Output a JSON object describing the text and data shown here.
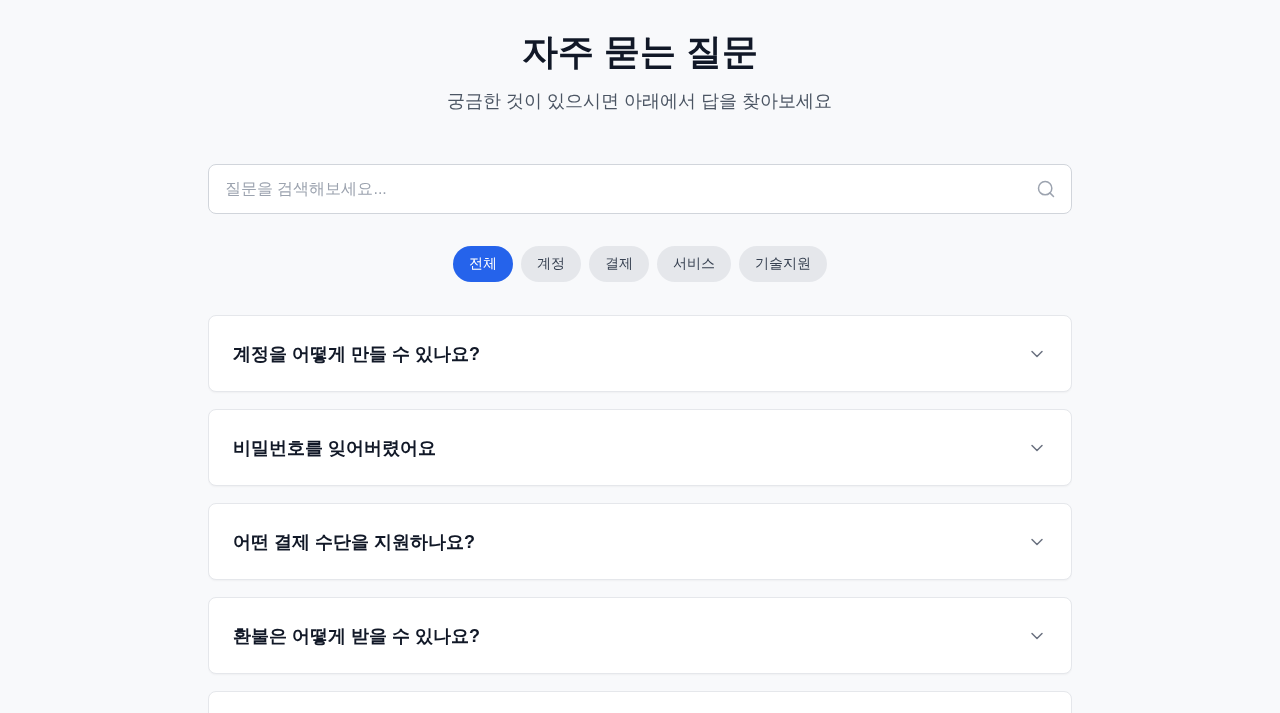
{
  "header": {
    "title": "자주 묻는 질문",
    "subtitle": "궁금한 것이 있으시면 아래에서 답을 찾아보세요"
  },
  "search": {
    "placeholder": "질문을 검색해보세요..."
  },
  "categories": [
    {
      "label": "전체",
      "selected": true
    },
    {
      "label": "계정",
      "selected": false
    },
    {
      "label": "결제",
      "selected": false
    },
    {
      "label": "서비스",
      "selected": false
    },
    {
      "label": "기술지원",
      "selected": false
    }
  ],
  "faqs": [
    {
      "question": "계정을 어떻게 만들 수 있나요?",
      "expanded": false
    },
    {
      "question": "비밀번호를 잊어버렸어요",
      "expanded": false
    },
    {
      "question": "어떤 결제 수단을 지원하나요?",
      "expanded": false
    },
    {
      "question": "환불은 어떻게 받을 수 있나요?",
      "expanded": false
    }
  ]
}
